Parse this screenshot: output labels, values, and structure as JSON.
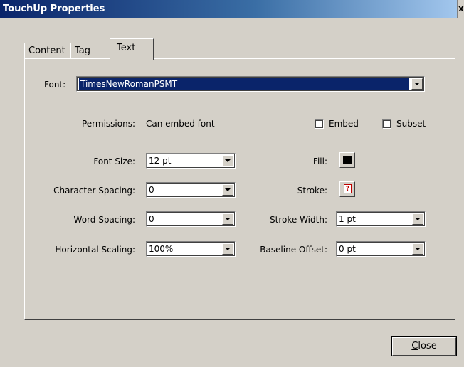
{
  "window": {
    "title": "TouchUp Properties",
    "close_glyph": "x"
  },
  "tabs": [
    {
      "label": "Content"
    },
    {
      "label": "Tag"
    },
    {
      "label": "Text"
    }
  ],
  "font": {
    "label": "Font:",
    "value": "TimesNewRomanPSMT"
  },
  "permissions": {
    "label": "Permissions:",
    "value": "Can embed font"
  },
  "embed": {
    "label": "Embed",
    "checked": false
  },
  "subset": {
    "label": "Subset",
    "checked": false
  },
  "font_size": {
    "label": "Font Size:",
    "value": "12 pt"
  },
  "character_spacing": {
    "label": "Character Spacing:",
    "value": "0"
  },
  "word_spacing": {
    "label": "Word Spacing:",
    "value": "0"
  },
  "horizontal_scaling": {
    "label": "Horizontal Scaling:",
    "value": "100%"
  },
  "fill": {
    "label": "Fill:",
    "color": "#000000"
  },
  "stroke": {
    "label": "Stroke:",
    "glyph": "?"
  },
  "stroke_width": {
    "label": "Stroke Width:",
    "value": "1 pt"
  },
  "baseline_offset": {
    "label": "Baseline Offset:",
    "value": "0 pt"
  },
  "close_button": {
    "mnemonic": "C",
    "rest": "lose"
  }
}
